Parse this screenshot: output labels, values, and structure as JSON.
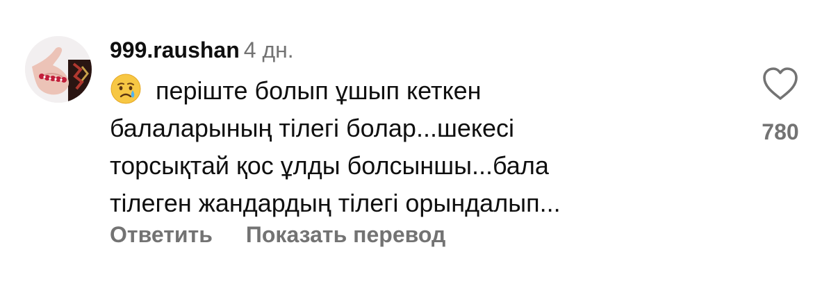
{
  "comment": {
    "username": "999.raushan",
    "time": "4 дн.",
    "emoji": "crying-face",
    "lines": [
      "перiште болып ұшып кеткен",
      "балаларының тiлегi болар...шекесi",
      "торсықтай қос ұлды болсыншы...бала",
      "тiлеген жандардың тiлегi орындалып..."
    ],
    "like_count": "780"
  },
  "actions": {
    "reply_label": "Ответить",
    "translate_label": "Показать перевод"
  },
  "icons": {
    "like": "heart-outline-icon",
    "avatar": "avatar-photo"
  },
  "colors": {
    "secondary_text": "#737373",
    "primary_text": "#0f0f0f"
  }
}
